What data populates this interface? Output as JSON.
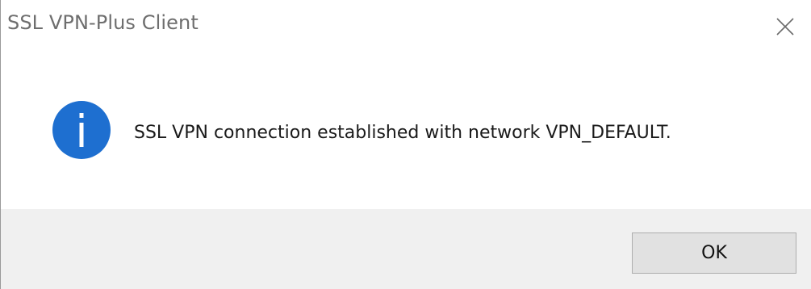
{
  "window": {
    "title": "SSL VPN-Plus Client",
    "close_icon": "close-icon"
  },
  "message": {
    "icon": "info-icon",
    "text": "SSL VPN connection established with network VPN_DEFAULT."
  },
  "footer": {
    "ok_label": "OK"
  },
  "colors": {
    "info_blue": "#1e6fd0",
    "footer_bg": "#f0f0f0",
    "button_bg": "#e1e1e1"
  }
}
